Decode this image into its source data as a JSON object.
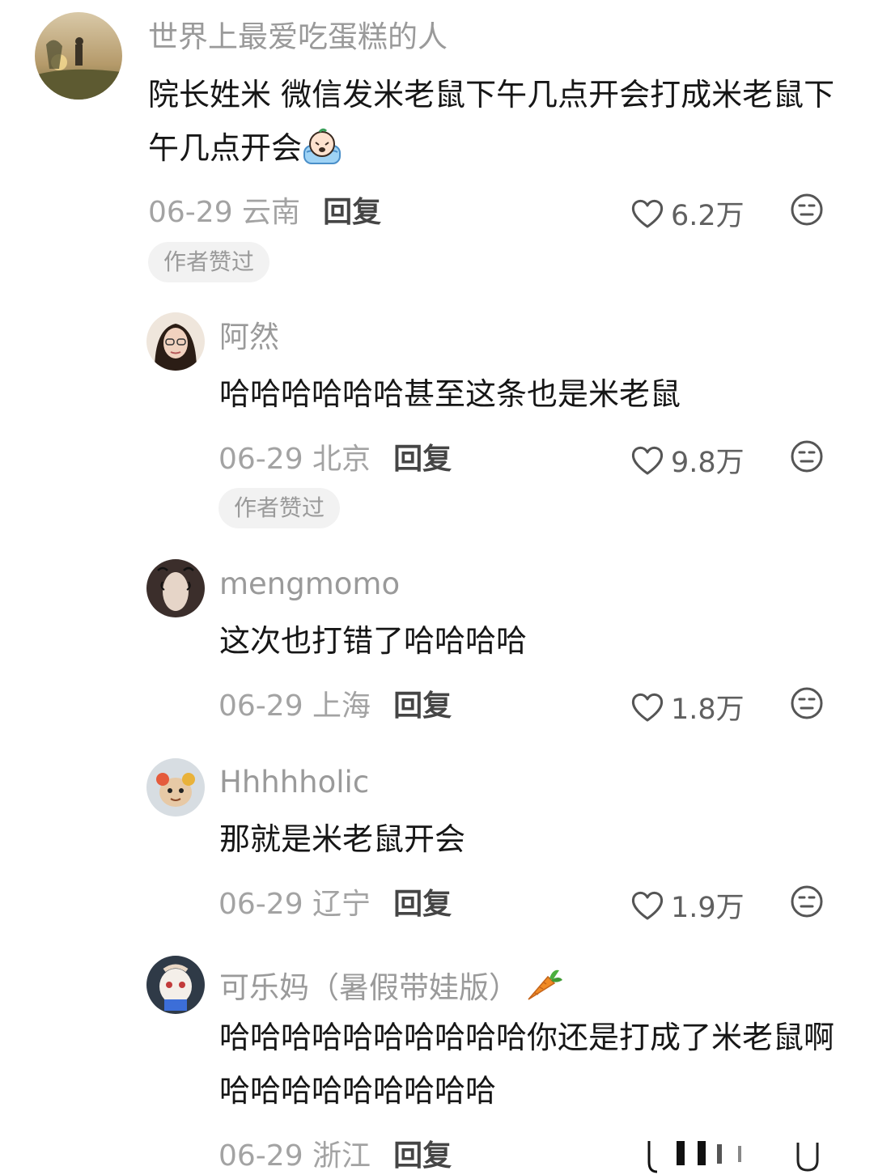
{
  "comments": [
    {
      "username": "世界上最爱吃蛋糕的人",
      "text": "院长姓米 微信发米老鼠下午几点开会打成米老鼠下午几点开会",
      "date_location": "06-29 云南",
      "reply_label": "回复",
      "likes": "6.2万",
      "badge": "作者赞过"
    },
    {
      "username": "阿然",
      "text": "哈哈哈哈哈哈甚至这条也是米老鼠",
      "date_location": "06-29 北京",
      "reply_label": "回复",
      "likes": "9.8万",
      "badge": "作者赞过"
    },
    {
      "username": "mengmomo",
      "text": "这次也打错了哈哈哈哈",
      "date_location": "06-29 上海",
      "reply_label": "回复",
      "likes": "1.8万"
    },
    {
      "username": "Hhhhholic",
      "text": "那就是米老鼠开会",
      "date_location": "06-29 辽宁",
      "reply_label": "回复",
      "likes": "1.9万"
    },
    {
      "username": "可乐妈（暑假带娃版）",
      "text": "哈哈哈哈哈哈哈哈哈哈你还是打成了米老鼠啊哈哈哈哈哈哈哈哈哈",
      "date_location": "06-29 浙江",
      "reply_label": "回复"
    }
  ],
  "icons": {
    "like": "heart-outline-icon",
    "more": "neutral-face-icon",
    "emoji": "crying-emoji",
    "carrot": "carrot-emoji"
  },
  "colors": {
    "username": "#9a9a9a",
    "text": "#161616",
    "meta": "#a3a3a3",
    "badge_bg": "#f2f2f2"
  }
}
